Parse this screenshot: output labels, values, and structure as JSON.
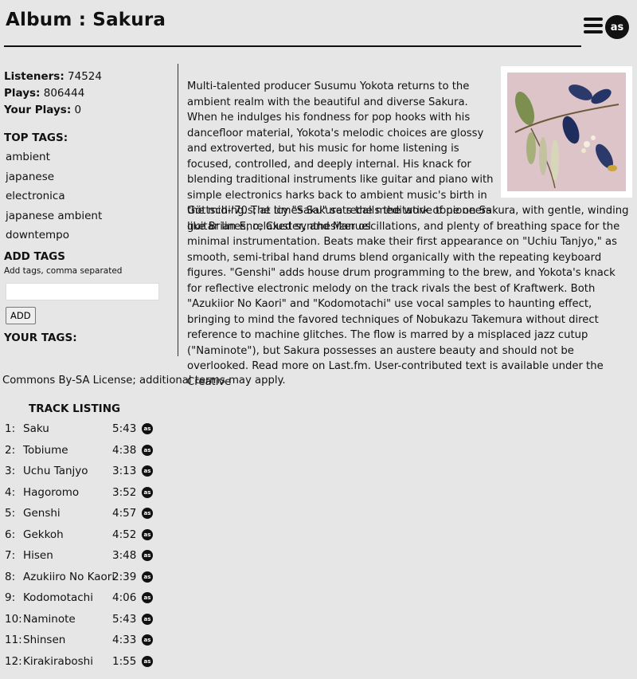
{
  "album": {
    "title": "Album : Sakura",
    "logo_text": "as"
  },
  "stats": {
    "listeners_label": "Listeners:",
    "listeners_value": "74524",
    "plays_label": "Plays:",
    "plays_value": "806444",
    "your_plays_label": "Your Plays:",
    "your_plays_value": "0"
  },
  "tags": {
    "top_heading": "TOP TAGS:",
    "items": [
      "ambient",
      "japanese",
      "electronica",
      "japanese ambient",
      "downtempo"
    ],
    "add_heading": "ADD TAGS",
    "add_hint": "Add tags, comma separated",
    "input_value": "",
    "add_button": "ADD",
    "your_heading": "YOUR TAGS:"
  },
  "bio": {
    "top": "Multi-talented producer Susumu Yokota returns to the ambient realm with the beautiful and diverse Sakura. When he indulges his fondness for pop hooks with his dancefloor material, Yokota's melodic choices are glossy and extroverted, but his music for home listening is focused, controlled, and deeply internal. His knack for blending traditional instruments like guitar and piano with simple electronics harks back to ambient music's birth in the mid-'70s; at times Sakura recalls the work of pioneers like Brian Eno, Cluster, and Manuel",
    "bottom": "Göttsching. The icy \"Saku\" sets the meditative tone on Sakura, with gentle, winding guitar lines, relaxed synthesizer oscillations, and plenty of breathing space for the minimal instrumentation. Beats make their first appearance on \"Uchiu Tanjyo,\" as smooth, semi-tribal hand drums blend organically with the repeating keyboard figures. \"Genshi\" adds house drum programming to the brew, and Yokota's knack for reflective electronic melody on the track rivals the best of Kraftwerk. Both \"Azukiior No Kaori\" and \"Kodomotachi\" use vocal samples to haunting effect, bringing to mind the favored techniques of Nobukazu Takemura without direct reference to machine glitches. The flow is marred by a misplaced jazz cutup (\"Naminote\"), but Sakura possesses an austere beauty and should not be overlooked.",
    "read_more": "Read more on Last.fm",
    "license_a": ". User-contributed text is available under the Creative",
    "license_b": "Commons By-SA License; additional terms may apply."
  },
  "tracks": {
    "heading": "TRACK LISTING",
    "items": [
      {
        "num": "1:",
        "name": "Saku",
        "duration": "5:43"
      },
      {
        "num": "2:",
        "name": "Tobiume",
        "duration": "4:38"
      },
      {
        "num": "3:",
        "name": "Uchu Tanjyo",
        "duration": "3:13"
      },
      {
        "num": "4:",
        "name": "Hagoromo",
        "duration": "3:52"
      },
      {
        "num": "5:",
        "name": "Genshi",
        "duration": "4:57"
      },
      {
        "num": "6:",
        "name": "Gekkoh",
        "duration": "4:52"
      },
      {
        "num": "7:",
        "name": "Hisen",
        "duration": "3:48"
      },
      {
        "num": "8:",
        "name": "Azukiiro No Kaori",
        "duration": "2:39"
      },
      {
        "num": "9:",
        "name": "Kodomotachi",
        "duration": "4:06"
      },
      {
        "num": "10:",
        "name": "Naminote",
        "duration": "5:43"
      },
      {
        "num": "11:",
        "name": "Shinsen",
        "duration": "4:33"
      },
      {
        "num": "12:",
        "name": "Kirakiraboshi",
        "duration": "1:55"
      }
    ]
  },
  "colors": {
    "background": "#e6e6e6",
    "text": "#111111",
    "cover_bg": "#dcc4c8"
  }
}
